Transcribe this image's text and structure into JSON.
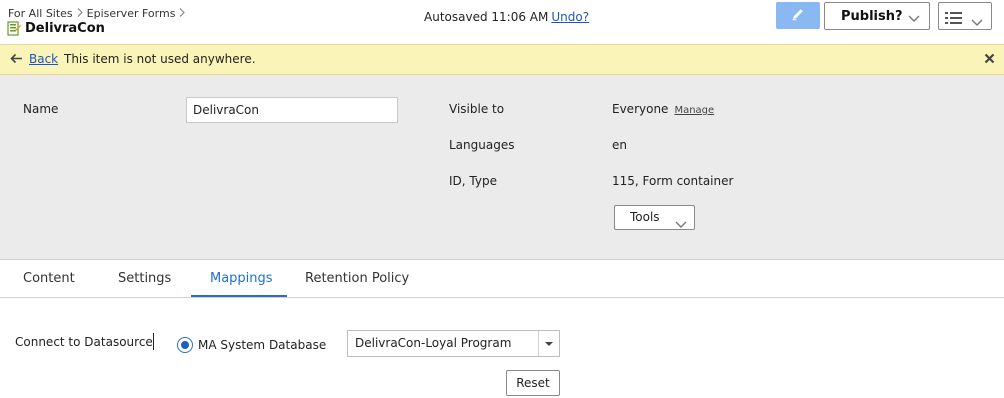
{
  "header": {
    "breadcrumb": [
      "For All Sites",
      "Episerver Forms"
    ],
    "title": "DelivraCon",
    "autosave_text": "Autosaved 11:06 AM",
    "undo_label": "Undo?",
    "publish_label": "Publish?",
    "edit_button_color": "#8ab8f2"
  },
  "notice": {
    "back_label": "Back",
    "message": "This item is not used anywhere.",
    "background": "#fbf4b8"
  },
  "properties": {
    "name_label": "Name",
    "name_value": "DelivraCon",
    "visible_to_label": "Visible to",
    "visible_to_value": "Everyone",
    "manage_label": "Manage",
    "languages_label": "Languages",
    "languages_value": "en",
    "id_type_label": "ID, Type",
    "id_type_value": "115, Form container",
    "tools_label": "Tools"
  },
  "tabs": [
    {
      "label": "Content",
      "active": false
    },
    {
      "label": "Settings",
      "active": false
    },
    {
      "label": "Mappings",
      "active": true
    },
    {
      "label": "Retention Policy",
      "active": false
    }
  ],
  "mapping": {
    "connect_label": "Connect to Datasource",
    "radio_label": "MA System Database",
    "radio_selected": true,
    "select_value": "DelivraCon-Loyal Program",
    "reset_label": "Reset"
  },
  "colors": {
    "accent": "#1f6fcf",
    "link": "#1a55c8",
    "panel_bg": "#ebebeb"
  }
}
